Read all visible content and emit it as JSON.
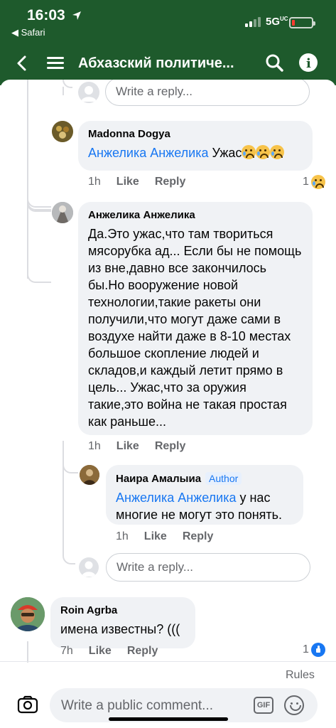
{
  "status": {
    "time": "16:03",
    "back_app": "◀ Safari",
    "network": "5G",
    "network_sub": "UC"
  },
  "nav": {
    "title": "Абхазский политиче..."
  },
  "reply_placeholder": "Write a reply...",
  "comments": [
    {
      "author": "Madonna Dogya",
      "mention": "Анжелика Анжелика",
      "text": " Ужас",
      "time": "1h",
      "like": "Like",
      "reply": "Reply",
      "reaction_count": "1"
    },
    {
      "author": "Анжелика Анжелика",
      "text": "Да.Это ужас,что там твориться мясорубка ад... Если бы не помощь из вне,давно все закончилось бы.Но вооружение новой технологии,такие ракеты они получили,что могут даже сами в воздухе найти даже в 8-10 местах большое скопление людей и складов,и каждый летит прямо в цель... Ужас,что за оружия такие,это война не такая простая как раньше...",
      "time": "1h",
      "like": "Like",
      "reply": "Reply"
    },
    {
      "author": "Наира Амалыиа",
      "badge": "Author",
      "mention": "Анжелика Анжелика",
      "text": " у нас многие не могут это понять.",
      "time": "1h",
      "like": "Like",
      "reply": "Reply"
    },
    {
      "author": "Roin Agrba",
      "text": "имена известны? (((",
      "time": "7h",
      "like": "Like",
      "reply": "Reply",
      "reaction_count": "1"
    }
  ],
  "footer": {
    "rules": "Rules",
    "composer_placeholder": "Write a public comment...",
    "gif": "GIF"
  },
  "colors": {
    "brand_green": "#1e5a2c",
    "link_blue": "#1877f2",
    "bubble": "#f0f2f5"
  }
}
